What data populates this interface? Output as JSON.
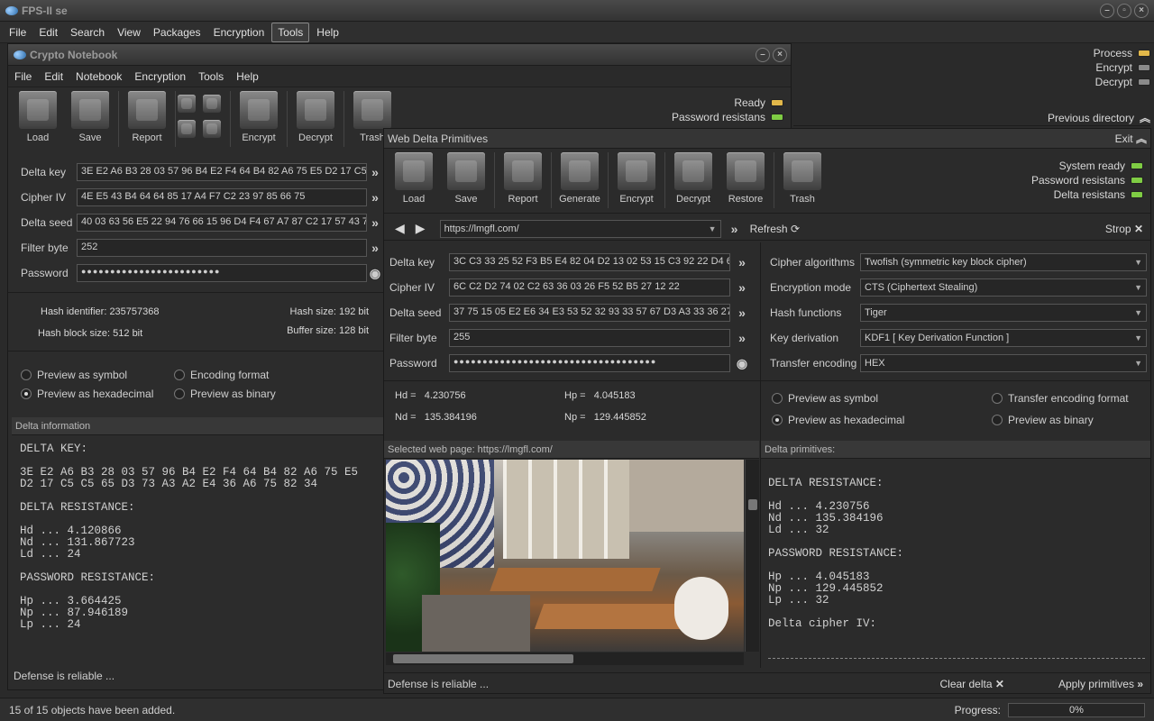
{
  "app": {
    "title": "FPS-II se",
    "menu": [
      "File",
      "Edit",
      "Search",
      "View",
      "Packages",
      "Encryption",
      "Tools",
      "Help"
    ],
    "status": "15 of 15 objects have been added.",
    "progress_label": "Progress:",
    "progress_value": "0%",
    "right_status": [
      {
        "label": "Process",
        "color": "#e2b84a"
      },
      {
        "label": "Encrypt",
        "color": "#8a8a8a"
      },
      {
        "label": "Decrypt",
        "color": "#8a8a8a"
      }
    ],
    "previous_directory": "Previous directory"
  },
  "notebook": {
    "title": "Crypto Notebook",
    "menu": [
      "File",
      "Edit",
      "Notebook",
      "Encryption",
      "Tools",
      "Help"
    ],
    "toolbar": [
      "Load",
      "Save",
      "Report",
      "Encrypt",
      "Decrypt",
      "Trash"
    ],
    "status": [
      {
        "label": "Ready",
        "color": "#e2b84a"
      },
      {
        "label": "Password resistans",
        "color": "#7fcc44"
      }
    ],
    "fields": [
      {
        "label": "Delta key",
        "value": "3E E2 A6 B3 28 03 57 96 B4 E2 F4 64 B4 82 A6 75 E5 D2 17 C5 C5"
      },
      {
        "label": "Cipher IV",
        "value": "4E E5 43 B4 64 64 85 17 A4 F7 C2 23 97 85 66 75"
      },
      {
        "label": "Delta seed",
        "value": "40 03 63 56 E5 22 94 76 66 15 96 D4 F4 67 A7 87 C2 17 57 43 73"
      },
      {
        "label": "Filter byte",
        "value": "252"
      },
      {
        "label": "Password",
        "value": "●●●●●●●●●●●●●●●●●●●●●●●●"
      }
    ],
    "hash": {
      "id_label": "Hash identifier:",
      "id_value": "235757368",
      "size_label": "Hash size:",
      "size_value": "192 bit",
      "block_label": "Hash block size:",
      "block_value": "512 bit",
      "buffer_label": "Buffer size:",
      "buffer_value": "128 bit"
    },
    "radios": [
      "Preview as symbol",
      "Encoding format",
      "Preview as hexadecimal",
      "Preview as binary"
    ],
    "info_title": "Delta information",
    "info_text": "DELTA KEY:\n\n3E E2 A6 B3 28 03 57 96 B4 E2 F4 64 B4 82 A6 75 E5\nD2 17 C5 C5 65 D3 73 A3 A2 E4 36 A6 75 82 34\n\nDELTA RESISTANCE:\n\nHd ... 4.120866\nNd ... 131.867723\nLd ... 24\n\nPASSWORD RESISTANCE:\n\nHp ... 3.664425\nNp ... 87.946189\nLp ... 24",
    "footer": "Defense is reliable ..."
  },
  "web": {
    "title": "Web Delta Primitives",
    "exit": "Exit",
    "toolbar": [
      "Load",
      "Save",
      "Report",
      "Generate",
      "Encrypt",
      "Decrypt",
      "Restore",
      "Trash"
    ],
    "status": [
      {
        "label": "System ready",
        "color": "#7fcc44"
      },
      {
        "label": "Password resistans",
        "color": "#7fcc44"
      },
      {
        "label": "Delta resistans",
        "color": "#7fcc44"
      }
    ],
    "url": "https://lmgfl.com/",
    "refresh": "Refresh",
    "stop": "Strop",
    "fields": [
      {
        "label": "Delta key",
        "value": "3C C3 33 25 52 F3 B5 E4 82 04 D2 13 02 53 15 C3 92 22 D4 64 0"
      },
      {
        "label": "Cipher IV",
        "value": "6C C2 D2 74 02 C2 63 36 03 26 F5 52 B5 27 12 22"
      },
      {
        "label": "Delta seed",
        "value": "37 75 15 05 E2 E6 34 E3 53 52 32 93 33 57 67 D3 A3 33 36 27 4"
      },
      {
        "label": "Filter byte",
        "value": "255"
      },
      {
        "label": "Password",
        "value": "●●●●●●●●●●●●●●●●●●●●●●●●●●●●●●●●●●●"
      }
    ],
    "options": [
      {
        "label": "Cipher algorithms",
        "value": "Twofish (symmetric key block cipher)"
      },
      {
        "label": "Encryption mode",
        "value": "CTS (Ciphertext Stealing)"
      },
      {
        "label": "Hash functions",
        "value": "Tiger"
      },
      {
        "label": "Key derivation",
        "value": "KDF1 [ Key Derivation Function ]"
      },
      {
        "label": "Transfer encoding",
        "value": "HEX"
      }
    ],
    "metrics": {
      "hd_label": "Hd =",
      "hd": "4.230756",
      "hp_label": "Hp =",
      "hp": "4.045183",
      "nd_label": "Nd =",
      "nd": "135.384196",
      "np_label": "Np =",
      "np": "129.445852"
    },
    "radios": [
      "Preview as symbol",
      "Transfer encoding format",
      "Preview as hexadecimal",
      "Preview as binary"
    ],
    "selected_page": "Selected web page: https://lmgfl.com/",
    "primitives_title": "Delta primitives:",
    "primitives_text": "DELTA RESISTANCE:\n\nHd ... 4.230756\nNd ... 135.384196\nLd ... 32\n\nPASSWORD RESISTANCE:\n\nHp ... 4.045183\nNp ... 129.445852\nLp ... 32\n\nDelta cipher IV:",
    "footer": "Defense is reliable ...",
    "clear_delta": "Clear delta",
    "apply": "Apply primitives"
  }
}
